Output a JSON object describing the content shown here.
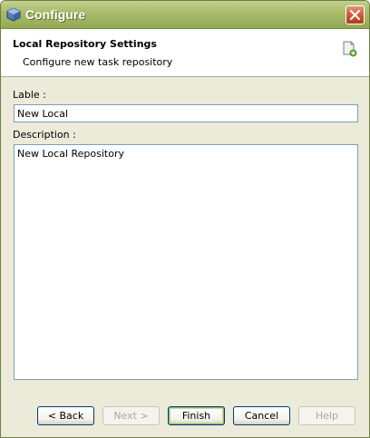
{
  "window": {
    "title": "Configure"
  },
  "header": {
    "title": "Local Repository Settings",
    "subtitle": "Configure new task repository"
  },
  "form": {
    "label_caption": "Lable :",
    "label_value": "New Local",
    "description_caption": "Description :",
    "description_value": "New Local Repository"
  },
  "buttons": {
    "back": "< Back",
    "next": "Next >",
    "finish": "Finish",
    "cancel": "Cancel",
    "help": "Help"
  }
}
